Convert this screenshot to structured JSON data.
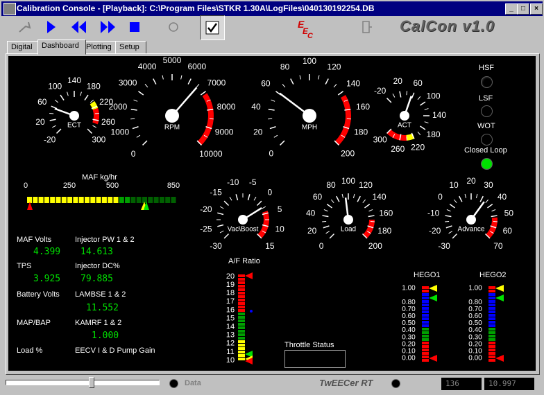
{
  "window": {
    "title": "Calibration Console - [Playback]: C:\\Program Files\\STKR 1.30A\\LogFiles\\040130192254.DB"
  },
  "toolbar": {
    "eec_logo": "EEC",
    "brand": "CalCon v1.0"
  },
  "tabs": [
    "Digital",
    "Dashboard",
    "Plotting",
    "Setup"
  ],
  "active_tab": "Dashboard",
  "gauges": {
    "ect": {
      "label": "ECT",
      "ticks": [
        "-20",
        "20",
        "60",
        "100",
        "140",
        "180",
        "220",
        "260",
        "300"
      ]
    },
    "rpm": {
      "label": "RPM",
      "ticks": [
        "0",
        "1000",
        "2000",
        "3000",
        "4000",
        "5000",
        "6000",
        "7000",
        "8000",
        "9000",
        "10000"
      ]
    },
    "mph": {
      "label": "MPH",
      "ticks": [
        "0",
        "20",
        "40",
        "60",
        "80",
        "100",
        "120",
        "140",
        "160",
        "180",
        "200"
      ]
    },
    "act": {
      "label": "ACT",
      "ticks": [
        "-20",
        "20",
        "60",
        "100",
        "140",
        "180",
        "220",
        "260",
        "300"
      ]
    },
    "vac": {
      "label": "Vac\\Boost",
      "ticks": [
        "-30",
        "-25",
        "-20",
        "-15",
        "-10",
        "-5",
        "0",
        "5",
        "10",
        "15"
      ]
    },
    "load": {
      "label": "Load",
      "ticks": [
        "0",
        "20",
        "40",
        "60",
        "80",
        "100",
        "120",
        "140",
        "160",
        "180",
        "200"
      ]
    },
    "advance": {
      "label": "Advance",
      "ticks": [
        "-30",
        "-20",
        "-10",
        "0",
        "10",
        "20",
        "30",
        "40",
        "50",
        "60",
        "70"
      ]
    }
  },
  "indicators": {
    "hsf": "HSF",
    "lsf": "LSF",
    "wot": "WOT",
    "closed_loop": "Closed Loop"
  },
  "maf_bar": {
    "title": "MAF kg/hr",
    "ticks": [
      "0",
      "250",
      "500",
      "850"
    ]
  },
  "readouts": {
    "maf_volts_label": "MAF Volts",
    "maf_volts": "4.399",
    "inj_pw_label": "Injector PW 1 & 2",
    "inj_pw": "14.613",
    "tps_label": "TPS",
    "tps": "3.925",
    "inj_dc_label": "Injector DC%",
    "inj_dc": "79.885",
    "battery_label": "Battery Volts",
    "lambse_label": "LAMBSE 1 & 2",
    "lambse": "11.552",
    "mapbap_label": "MAP/BAP",
    "kamrf_label": "KAMRF 1 & 2",
    "kamrf": "1.000",
    "load_pct_label": "Load %",
    "eecv_label": "EECV I & D Pump Gain"
  },
  "af_ratio": {
    "title": "A/F Ratio",
    "ticks": [
      "20",
      "19",
      "18",
      "17",
      "16",
      "15",
      "14",
      "13",
      "12",
      "11",
      "10"
    ]
  },
  "throttle_status": {
    "label": "Throttle Status"
  },
  "hego": {
    "hego1": "HEGO1",
    "hego2": "HEGO2",
    "ticks": [
      "1.00",
      "0.80",
      "0.70",
      "0.60",
      "0.50",
      "0.40",
      "0.30",
      "0.20",
      "0.10",
      "0.00"
    ]
  },
  "status": {
    "data_label": "Data",
    "logo": "TwEECer RT",
    "field1": "136",
    "field2": "10.997"
  }
}
